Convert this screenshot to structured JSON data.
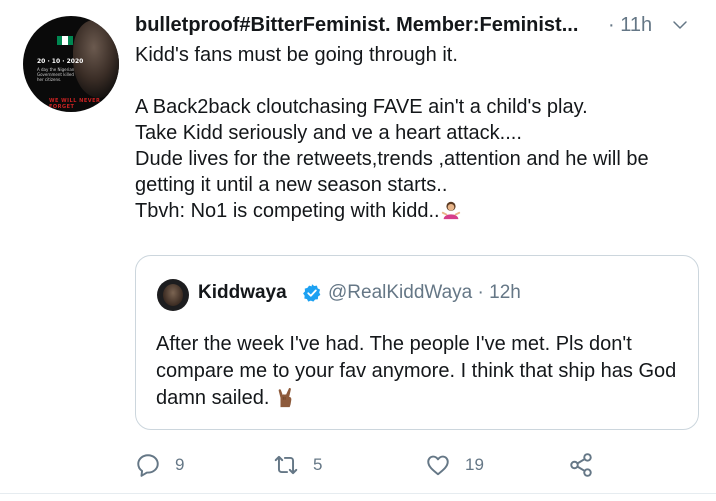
{
  "tweet": {
    "author_display": "bulletproof#BitterFeminist. Member:Feminist...",
    "time_separator": "·",
    "time": "11h",
    "avatar": {
      "poster_date": "20 · 10 · 2020",
      "poster_text": "A day the Nigerian Government killed her citizens.",
      "poster_banner": "WE WILL NEVER FORGET"
    },
    "body": {
      "line1": "Kidd's fans must be going through it.",
      "line2": "A Back2back cloutchasing FAVE  ain't a child's play.",
      "line3": "Take Kidd seriously and ve a heart attack....",
      "line4": "Dude lives for the retweets,trends ,attention  and he will be getting it until a new season starts..",
      "line5": "Tbvh: No1 is competing with kidd.."
    },
    "quoted": {
      "name": "Kiddwaya",
      "handle": "@RealKiddWaya",
      "time_separator": "·",
      "time": "12h",
      "text": "After the week I've had. The people I've met. Pls don't compare me to your fav anymore. I think that ship has God damn sailed."
    },
    "actions": {
      "reply_count": "9",
      "retweet_count": "5",
      "like_count": "19"
    }
  },
  "colors": {
    "secondary_text": "#657786",
    "verified_blue": "#1da1f2",
    "border": "#ccd6dd"
  }
}
